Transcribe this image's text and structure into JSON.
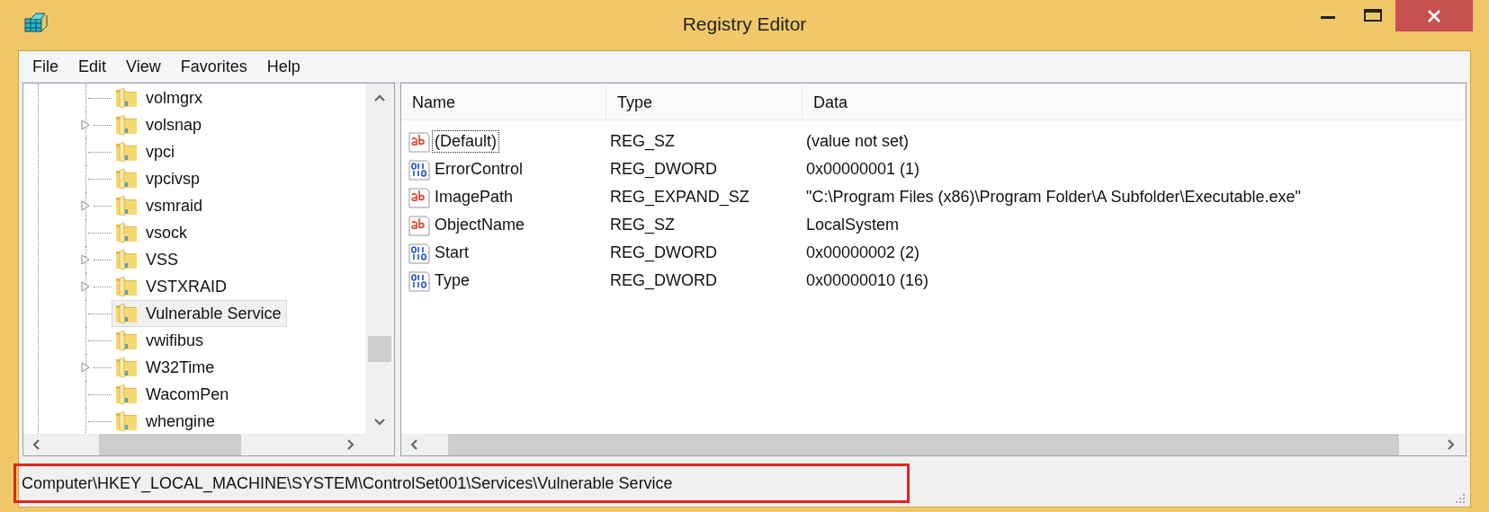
{
  "window": {
    "title": "Registry Editor"
  },
  "menu": [
    "File",
    "Edit",
    "View",
    "Favorites",
    "Help"
  ],
  "tree": {
    "items": [
      {
        "name": "volmgrx",
        "expandable": false,
        "selected": false
      },
      {
        "name": "volsnap",
        "expandable": true,
        "selected": false
      },
      {
        "name": "vpci",
        "expandable": false,
        "selected": false
      },
      {
        "name": "vpcivsp",
        "expandable": false,
        "selected": false
      },
      {
        "name": "vsmraid",
        "expandable": true,
        "selected": false
      },
      {
        "name": "vsock",
        "expandable": false,
        "selected": false
      },
      {
        "name": "VSS",
        "expandable": true,
        "selected": false
      },
      {
        "name": "VSTXRAID",
        "expandable": true,
        "selected": false
      },
      {
        "name": "Vulnerable Service",
        "expandable": false,
        "selected": true
      },
      {
        "name": "vwifibus",
        "expandable": false,
        "selected": false
      },
      {
        "name": "W32Time",
        "expandable": true,
        "selected": false
      },
      {
        "name": "WacomPen",
        "expandable": false,
        "selected": false
      },
      {
        "name": "whengine",
        "expandable": false,
        "selected": false
      }
    ]
  },
  "values": {
    "columns": [
      "Name",
      "Type",
      "Data"
    ],
    "rows": [
      {
        "kind": "string",
        "name": "(Default)",
        "type": "REG_SZ",
        "data": "(value not set)",
        "focused": true
      },
      {
        "kind": "binary",
        "name": "ErrorControl",
        "type": "REG_DWORD",
        "data": "0x00000001 (1)",
        "focused": false
      },
      {
        "kind": "string",
        "name": "ImagePath",
        "type": "REG_EXPAND_SZ",
        "data": "\"C:\\Program Files (x86)\\Program Folder\\A Subfolder\\Executable.exe\"",
        "focused": false
      },
      {
        "kind": "string",
        "name": "ObjectName",
        "type": "REG_SZ",
        "data": "LocalSystem",
        "focused": false
      },
      {
        "kind": "binary",
        "name": "Start",
        "type": "REG_DWORD",
        "data": "0x00000002 (2)",
        "focused": false
      },
      {
        "kind": "binary",
        "name": "Type",
        "type": "REG_DWORD",
        "data": "0x00000010 (16)",
        "focused": false
      }
    ]
  },
  "status_bar": {
    "text": "Computer\\HKEY_LOCAL_MACHINE\\SYSTEM\\ControlSet001\\Services\\Vulnerable Service",
    "highlighted": true
  }
}
